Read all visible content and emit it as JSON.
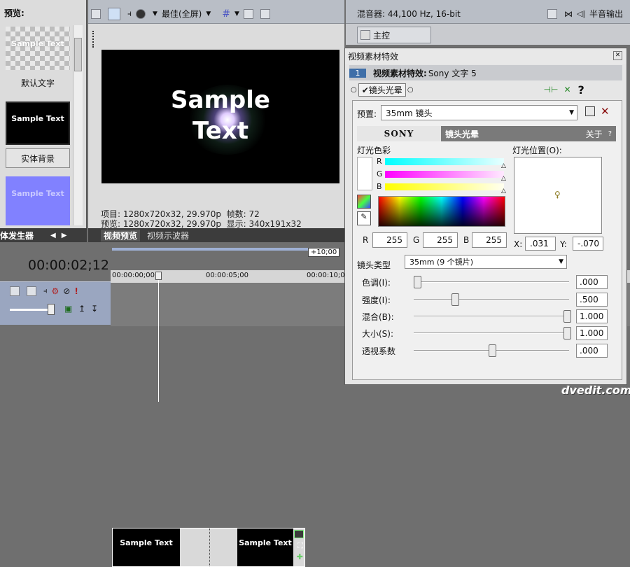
{
  "left_panel": {
    "title": "预览:",
    "items": [
      {
        "thumb_text": "Sample Text",
        "label": "默认文字"
      },
      {
        "thumb_text": "Sample Text",
        "label": "实体背景"
      },
      {
        "thumb_text": "Sample Text"
      }
    ],
    "tab_generator": "媒体发生器"
  },
  "preview": {
    "quality": "最佳(全屏)",
    "sample_text": "Sample Text",
    "info_line1_a": "项目: 1280x720x32, 29.970p",
    "info_line1_b": "帧数: 72",
    "info_line2_a": "预览: 1280x720x32, 29.970p",
    "info_line2_b": "显示: 340x191x32",
    "tab_preview": "视频预览",
    "tab_scopes": "视频示波器"
  },
  "mixer": {
    "title": "混音器: 44,100 Hz, 16-bit",
    "half_output": "半音输出",
    "master": "主控"
  },
  "timeline": {
    "timecode": "00:00:02;12",
    "offset": "+10;00",
    "ruler_0": "00:00:00;00",
    "ruler_1": "00:00:05;00",
    "ruler_2": "00:00:10;00",
    "clip_text": "Sample Text"
  },
  "fx_dialog": {
    "window_title": "视频素材特效",
    "chain_num": "1",
    "header_label": "视频素材特效:",
    "header_value": "Sony 文字 5",
    "effect_checkbox": "镜头光晕",
    "preset_label": "预置:",
    "preset_value": "35mm 镜头",
    "sony_brand": "SONY",
    "plugin_name": "镜头光晕",
    "about": "关于",
    "help": "?",
    "light_color": "灯光色彩",
    "channel_r": "R",
    "channel_g": "G",
    "channel_b": "B",
    "rgb_r_label": "R",
    "rgb_r_value": "255",
    "rgb_g_label": "G",
    "rgb_g_value": "255",
    "rgb_b_label": "B",
    "rgb_b_value": "255",
    "light_position": "灯光位置(O):",
    "x_label": "X:",
    "x_value": ".031",
    "y_label": "Y:",
    "y_value": "-.070",
    "lens_type_label": "镜头类型",
    "lens_type_value": "35mm (9 个镜片)",
    "params": [
      {
        "label": "色调(I):",
        "value": ".000",
        "level": 0.0
      },
      {
        "label": "强度(I):",
        "value": ".500",
        "level": 0.25
      },
      {
        "label": "混合(B):",
        "value": "1.000",
        "level": 1.0
      },
      {
        "label": "大小(S):",
        "value": "1.000",
        "level": 1.0
      },
      {
        "label": "透视系数",
        "value": ".000",
        "level": 0.5
      }
    ]
  },
  "watermark": "dvedit.com"
}
